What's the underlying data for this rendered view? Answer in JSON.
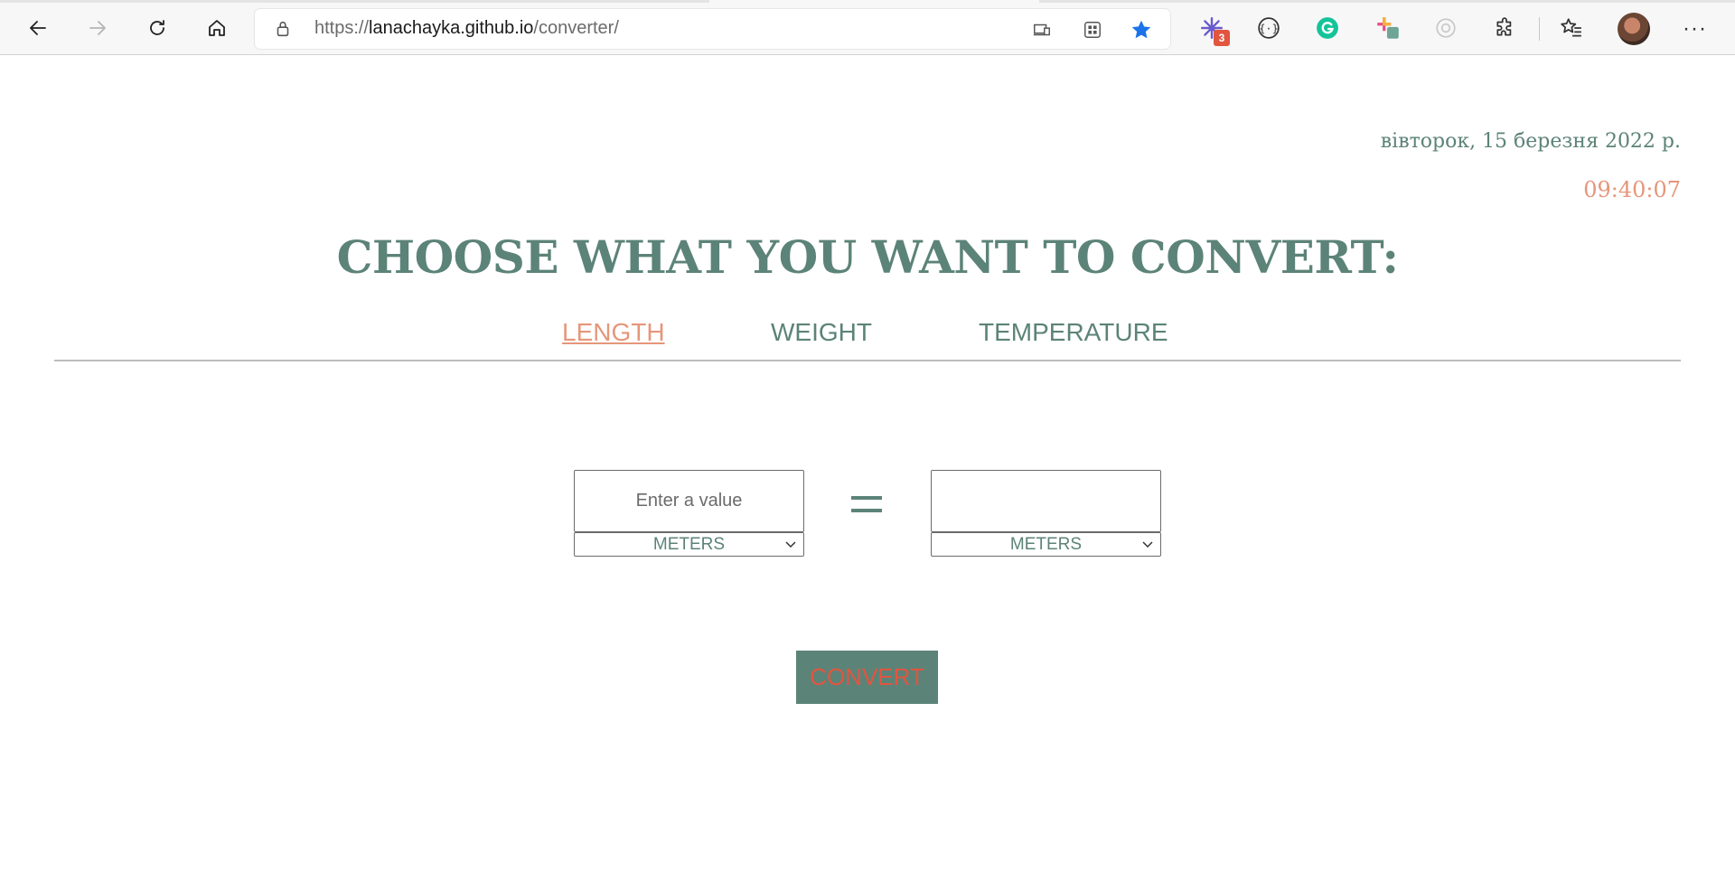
{
  "browser": {
    "url_prefix": "https://",
    "url_host": "lanachayka.github.io",
    "url_path": "/converter/",
    "extension_badge": "3"
  },
  "clock": {
    "date": "вівторок, 15 березня 2022 р.",
    "time": "09:40:07"
  },
  "header": {
    "title": "CHOOSE WHAT YOU WANT TO CONVERT:"
  },
  "tabs": [
    {
      "label": "LENGTH",
      "active": true
    },
    {
      "label": "WEIGHT",
      "active": false
    },
    {
      "label": "TEMPERATURE",
      "active": false
    }
  ],
  "converter": {
    "from_placeholder": "Enter a value",
    "from_value": "",
    "to_value": "",
    "from_unit": "METERS",
    "to_unit": "METERS",
    "convert_label": "CONVERT"
  },
  "colors": {
    "primary": "#5c8378",
    "accent": "#e6967a",
    "button_text": "#e2553f"
  }
}
